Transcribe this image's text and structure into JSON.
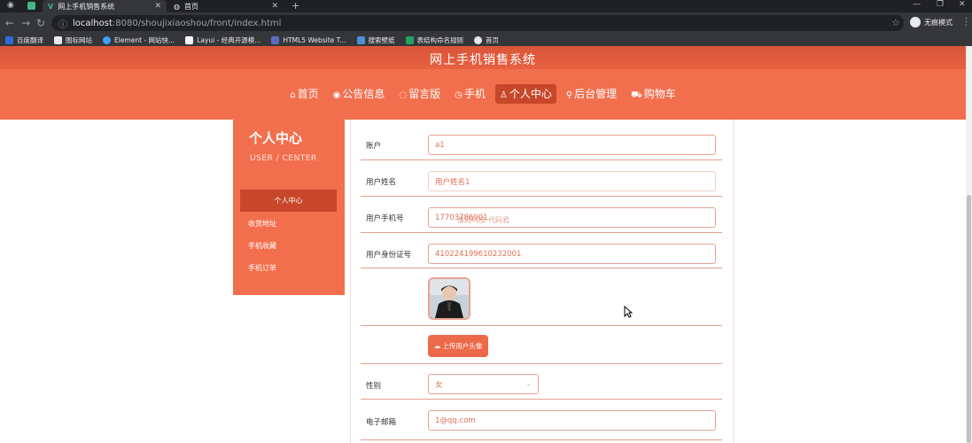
{
  "browser": {
    "tabs": [
      {
        "title": "网上手机销售系统",
        "active": true
      },
      {
        "title": "首页",
        "active": false
      }
    ],
    "new_tab": "+",
    "url_host": "localhost",
    "url_rest": ":8080/shoujixiaoshou/front/index.html",
    "profile_label": "无痕模式",
    "bookmarks": [
      {
        "label": "百度翻译",
        "color": "#2f6bd8"
      },
      {
        "label": "图标网站",
        "color": "#222222"
      },
      {
        "label": "Element - 网站快...",
        "color": "#409eff"
      },
      {
        "label": "Layui - 经典开源模...",
        "color": "#ffffff"
      },
      {
        "label": "HTML5 Website T...",
        "color": "#5c6bc0"
      },
      {
        "label": "搜索壁纸",
        "color": "#4a90d9"
      },
      {
        "label": "表结构命名规则",
        "color": "#21a366"
      },
      {
        "label": "首页",
        "color": "#e8eaed"
      }
    ]
  },
  "site": {
    "title": "网上手机销售系统",
    "nav": [
      {
        "label": "首页",
        "icon": "home-icon",
        "glyph": "⌂",
        "active": false
      },
      {
        "label": "公告信息",
        "icon": "eye-icon",
        "glyph": "◉",
        "active": false
      },
      {
        "label": "留言版",
        "icon": "chat-icon",
        "glyph": "◌",
        "active": false
      },
      {
        "label": "手机",
        "icon": "clock-icon",
        "glyph": "◷",
        "active": false
      },
      {
        "label": "个人中心",
        "icon": "user-icon",
        "glyph": "♙",
        "active": true
      },
      {
        "label": "后台管理",
        "icon": "link-icon",
        "glyph": "⚲",
        "active": false
      },
      {
        "label": "购物车",
        "icon": "cart-icon",
        "glyph": "⛟",
        "active": false
      }
    ]
  },
  "sidebar": {
    "title": "个人中心",
    "subtitle": "USER / CENTER",
    "items": [
      {
        "label": "个人中心",
        "active": true
      },
      {
        "label": "收货地址",
        "active": false
      },
      {
        "label": "手机收藏",
        "active": false
      },
      {
        "label": "手机订单",
        "active": false
      }
    ]
  },
  "form": {
    "account": {
      "label": "账户",
      "value": "a1"
    },
    "name": {
      "label": "用户姓名",
      "placeholder": "用户姓名1"
    },
    "phone": {
      "label": "用户手机号",
      "value": "17703786901"
    },
    "idcard": {
      "label": "用户身份证号",
      "value": "410224199610232001"
    },
    "upload_label": "上传用户头像",
    "gender": {
      "label": "性别",
      "value": "女"
    },
    "email": {
      "label": "电子邮箱",
      "value": "1@qq.com"
    }
  },
  "watermark": "豫网科技-代码君",
  "colors": {
    "primary": "#f26f4e",
    "active": "#c8472a",
    "input_border": "#e7a291",
    "input_text": "#e06f55"
  }
}
